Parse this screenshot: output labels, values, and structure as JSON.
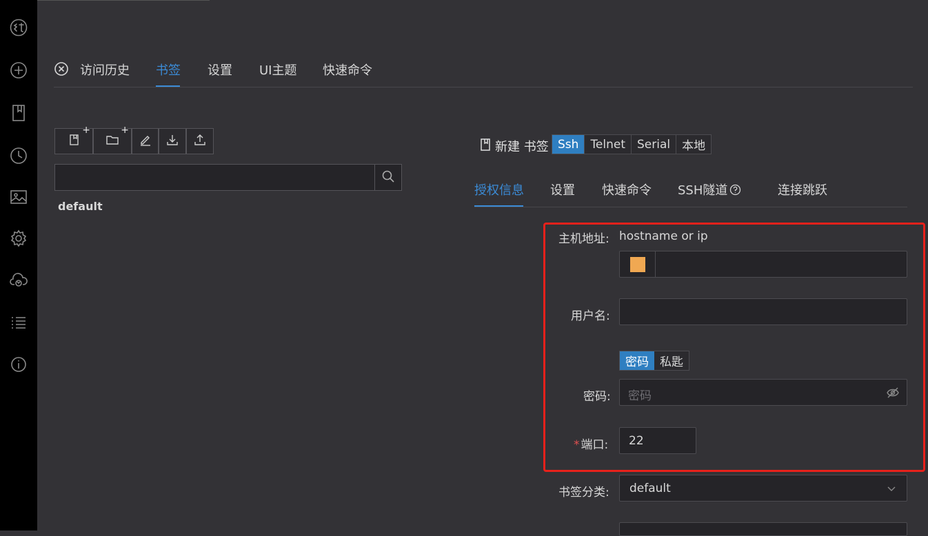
{
  "sidebar": {
    "items": [
      {
        "icon": "logo-icon"
      },
      {
        "icon": "plus-circle-icon"
      },
      {
        "icon": "bookmark-icon"
      },
      {
        "icon": "clock-icon"
      },
      {
        "icon": "image-icon"
      },
      {
        "icon": "gear-icon"
      },
      {
        "icon": "cloud-sync-icon"
      },
      {
        "icon": "list-icon"
      },
      {
        "icon": "info-icon"
      }
    ]
  },
  "top_tabs": [
    "访问历史",
    "书签",
    "设置",
    "UI主题",
    "快速命令"
  ],
  "active_top_tab": "书签",
  "toolbar": {
    "buttons": [
      {
        "icon": "new-bookmark-icon",
        "badge": "+"
      },
      {
        "icon": "new-folder-icon",
        "badge": "+"
      },
      {
        "icon": "edit-icon"
      },
      {
        "icon": "download-icon"
      },
      {
        "icon": "upload-icon"
      }
    ]
  },
  "search": {
    "placeholder": ""
  },
  "tree": {
    "items": [
      "default"
    ]
  },
  "form": {
    "title": "新建 书签",
    "protocols": [
      "Ssh",
      "Telnet",
      "Serial",
      "本地"
    ],
    "active_protocol": "Ssh",
    "tabs": [
      "授权信息",
      "设置",
      "快速命令",
      "SSH隧道",
      "连接跳跃"
    ],
    "active_tab": "授权信息",
    "host_label": "主机地址:",
    "host_hint": "hostname or ip",
    "host_color": "#f0a852",
    "host_value": "",
    "username_label": "用户名:",
    "username_value": "",
    "auth_types": [
      "密码",
      "私匙"
    ],
    "active_auth": "密码",
    "password_label": "密码:",
    "password_placeholder": "密码",
    "port_required_mark": "*",
    "port_label": "端口:",
    "port_value": "22",
    "category_label": "书签分类:",
    "category_value": "default"
  },
  "colors": {
    "accent": "#2f7fc1",
    "active_text": "#3b8bd6",
    "highlight_frame": "#e8211b"
  }
}
